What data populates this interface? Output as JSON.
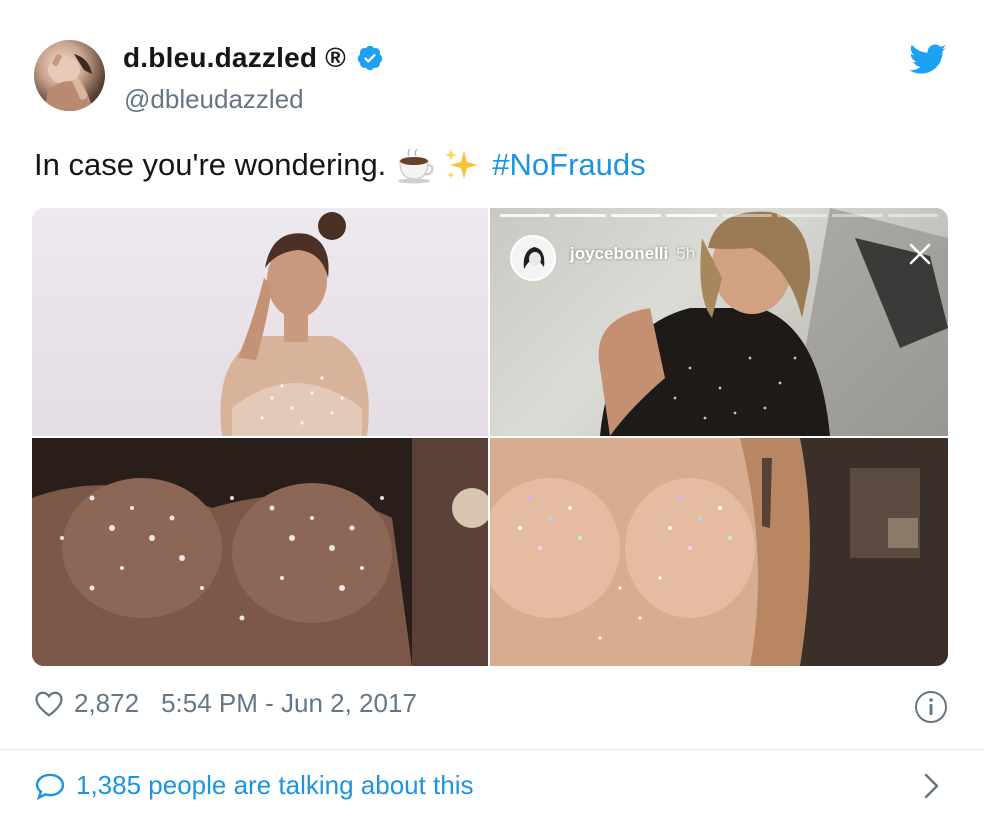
{
  "author": {
    "display_name": "d.bleu.dazzled ®",
    "handle": "@dbleudazzled"
  },
  "tweet": {
    "text": "In case you're wondering.",
    "hashtag": "#NoFrauds",
    "emoji": [
      "hot-beverage-emoji",
      "sparkles-emoji"
    ]
  },
  "media": {
    "story_overlay": {
      "username": "joycebonelli",
      "time": "5h"
    }
  },
  "meta": {
    "likes": "2,872",
    "timestamp": "5:54 PM - Jun 2, 2017"
  },
  "footer": {
    "talking": "1,385 people are talking about this"
  },
  "colors": {
    "accent": "#1b95e0",
    "secondary_text": "#657786",
    "divider": "#e6ecf0"
  }
}
